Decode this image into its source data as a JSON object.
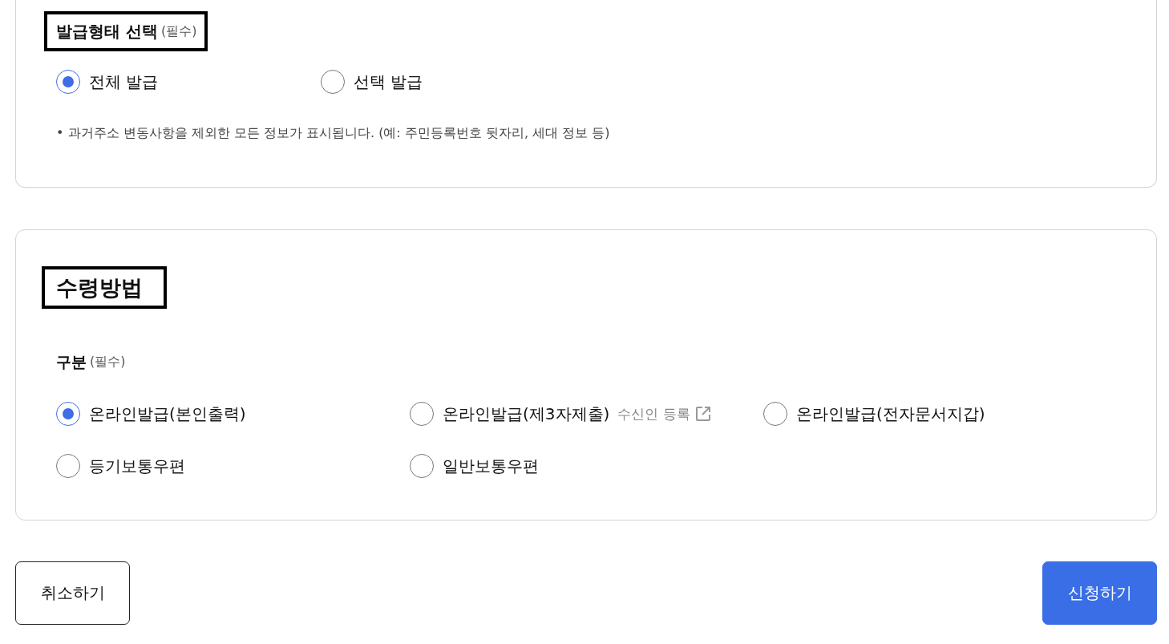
{
  "issue_type": {
    "title": "발급형태 선택",
    "required": "(필수)",
    "outlined": true,
    "options": [
      {
        "label": "전체 발급",
        "selected": true
      },
      {
        "label": "선택 발급",
        "selected": false
      }
    ],
    "note": "• 과거주소 변동사항을 제외한 모든 정보가 표시됩니다. (예: 주민등록번호 뒷자리, 세대 정보 등)"
  },
  "receipt_method": {
    "title": "수령방법",
    "outlined": true,
    "field_label": "구분",
    "required": "(필수)",
    "options": [
      {
        "label": "온라인발급(본인출력)",
        "selected": true
      },
      {
        "label": "온라인발급(제3자제출)",
        "selected": false,
        "link": "수신인 등록"
      },
      {
        "label": "온라인발급(전자문서지갑)",
        "selected": false
      },
      {
        "label": "등기보통우편",
        "selected": false
      },
      {
        "label": "일반보통우편",
        "selected": false
      }
    ]
  },
  "buttons": [
    {
      "label": "취소하기",
      "kind": "secondary"
    },
    {
      "label": "신청하기",
      "kind": "primary"
    }
  ]
}
